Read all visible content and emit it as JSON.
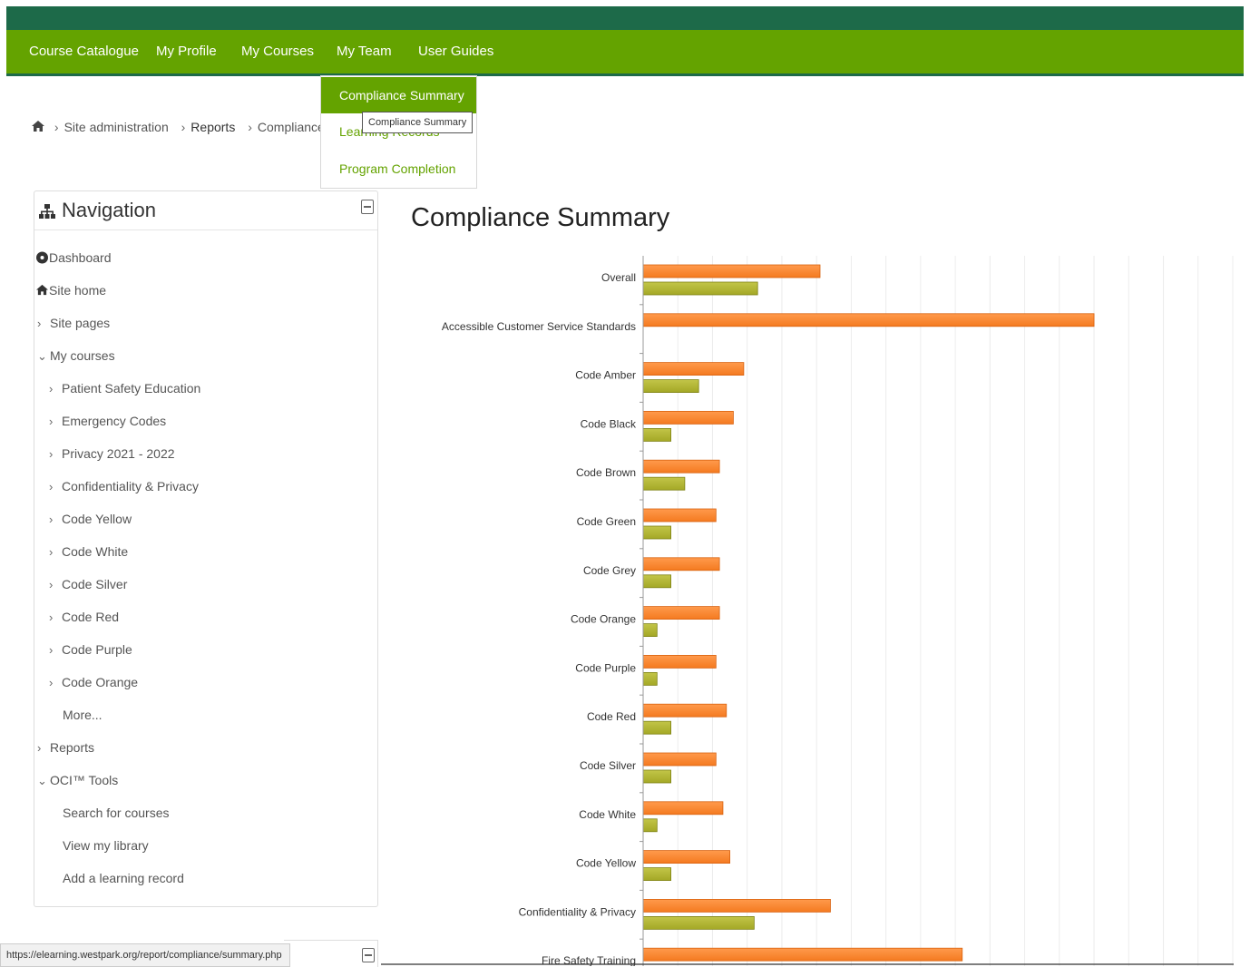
{
  "navbar": {
    "items": [
      "Course Catalogue",
      "My Profile",
      "My Courses",
      "My Team",
      "User Guides"
    ]
  },
  "dropdown": {
    "items": [
      "Compliance Summary",
      "Learning Records",
      "Program Completion"
    ],
    "tooltip": "Compliance Summary"
  },
  "breadcrumb": {
    "items": [
      "Site administration",
      "Reports",
      "Compliance S"
    ]
  },
  "navigation": {
    "title": "Navigation",
    "dashboard": "Dashboard",
    "site_home": "Site home",
    "site_pages": "Site pages",
    "my_courses": "My courses",
    "courses": [
      "Patient Safety Education",
      "Emergency Codes",
      "Privacy 2021 - 2022",
      "Confidentiality & Privacy",
      "Code Yellow",
      "Code White",
      "Code Silver",
      "Code Red",
      "Code Purple",
      "Code Orange"
    ],
    "more": "More...",
    "reports": "Reports",
    "oci_tools": "OCI™ Tools",
    "oci_items": [
      "Search for courses",
      "View my library",
      "Add a learning record"
    ]
  },
  "status_url": "https://elearning.westpark.org/report/compliance/summary.php",
  "main": {
    "title": "Compliance Summary"
  },
  "colors": {
    "orange": "#f47a20",
    "olive": "#a4a826",
    "nav_green": "#64a300",
    "top_green": "#1d6a49"
  },
  "chart_data": {
    "type": "bar",
    "orientation": "horizontal",
    "categories": [
      "Overall",
      "Accessible Customer Service Standards",
      "Code Amber",
      "Code Black",
      "Code Brown",
      "Code Green",
      "Code Grey",
      "Code Orange",
      "Code Purple",
      "Code Red",
      "Code Silver",
      "Code White",
      "Code Yellow",
      "Confidentiality & Privacy",
      "Fire Safety Training"
    ],
    "series": [
      {
        "values": [
          51,
          130,
          29,
          26,
          22,
          21,
          22,
          22,
          21,
          24,
          21,
          23,
          25,
          54,
          92
        ],
        "color": "#f47a20"
      },
      {
        "values": [
          33,
          0,
          16,
          8,
          12,
          8,
          8,
          4,
          4,
          8,
          8,
          4,
          8,
          32,
          null
        ],
        "color": "#a4a826"
      }
    ],
    "xlim": [
      0,
      170
    ],
    "grid": true
  }
}
